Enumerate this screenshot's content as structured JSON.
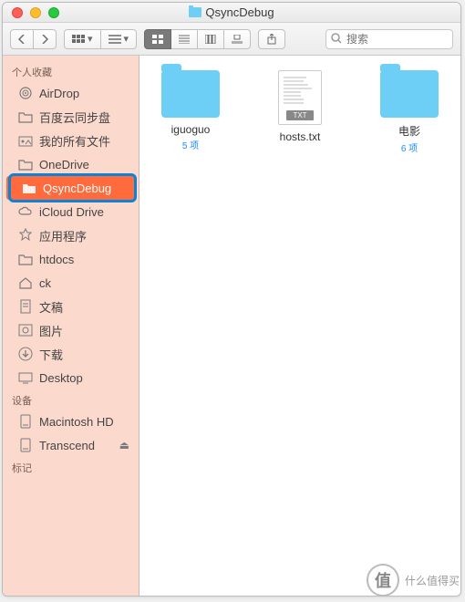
{
  "window": {
    "title": "QsyncDebug"
  },
  "toolbar": {
    "search_placeholder": "搜索"
  },
  "sidebar": {
    "sections": [
      {
        "header": "个人收藏",
        "items": [
          {
            "label": "AirDrop",
            "icon": "airdrop"
          },
          {
            "label": "百度云同步盘",
            "icon": "folder"
          },
          {
            "label": "我的所有文件",
            "icon": "allfiles"
          },
          {
            "label": "OneDrive",
            "icon": "folder"
          },
          {
            "label": "QsyncDebug",
            "icon": "folder-red",
            "selected": true,
            "highlighted": true
          },
          {
            "label": "iCloud Drive",
            "icon": "cloud"
          },
          {
            "label": "应用程序",
            "icon": "apps"
          },
          {
            "label": "htdocs",
            "icon": "folder"
          },
          {
            "label": "ck",
            "icon": "home"
          },
          {
            "label": "文稿",
            "icon": "documents"
          },
          {
            "label": "图片",
            "icon": "pictures"
          },
          {
            "label": "下载",
            "icon": "downloads"
          },
          {
            "label": "Desktop",
            "icon": "desktop"
          }
        ]
      },
      {
        "header": "设备",
        "items": [
          {
            "label": "Macintosh HD",
            "icon": "disk"
          },
          {
            "label": "Transcend",
            "icon": "disk",
            "ejectable": true
          }
        ]
      },
      {
        "header": "标记",
        "items": []
      }
    ]
  },
  "files": [
    {
      "name": "iguoguo",
      "type": "folder",
      "meta": "5 项"
    },
    {
      "name": "hosts.txt",
      "type": "txt",
      "meta": ""
    },
    {
      "name": "电影",
      "type": "folder",
      "meta": "6 项"
    }
  ],
  "watermark": {
    "char": "值",
    "text": "什么值得买"
  }
}
